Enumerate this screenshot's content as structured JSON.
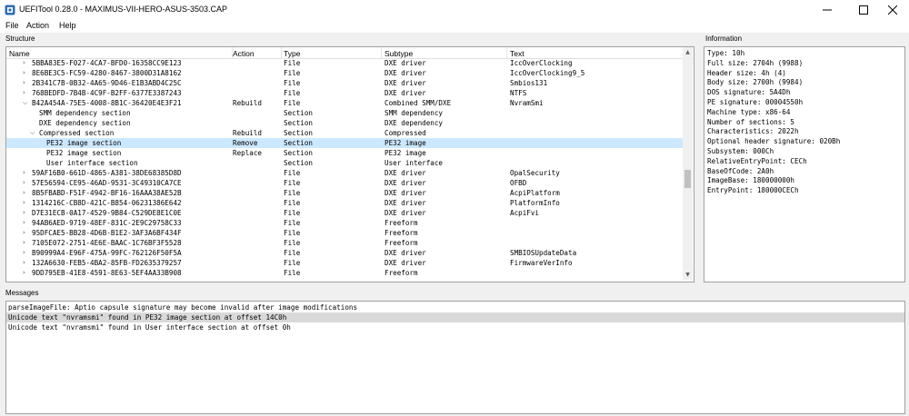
{
  "window": {
    "title": "UEFITool 0.28.0 - MAXIMUS-VII-HERO-ASUS-3503.CAP",
    "minimize_icon": "minimize-icon",
    "maximize_icon": "maximize-icon",
    "close_icon": "close-icon"
  },
  "menu": [
    "File",
    "Action",
    "Help"
  ],
  "structure": {
    "group_label": "Structure",
    "columns": [
      "Name",
      "Action",
      "Type",
      "Subtype",
      "Text"
    ],
    "rows": [
      {
        "chevron": ">",
        "name": "5BBA83E5-F027-4CA7-BFD0-16358CC9E123",
        "action": "",
        "type": "File",
        "subtype": "DXE driver",
        "text": "IccOverClocking",
        "selected": false
      },
      {
        "chevron": ">",
        "name": "8E6BE3C5-FC59-4280-8467-3800D31A8162",
        "action": "",
        "type": "File",
        "subtype": "DXE driver",
        "text": "IccOverClocking9_5",
        "selected": false
      },
      {
        "chevron": ">",
        "name": "2B341C7B-0B32-4A65-9D46-E1B3ABD4C25C",
        "action": "",
        "type": "File",
        "subtype": "DXE driver",
        "text": "Smbios131",
        "selected": false
      },
      {
        "chevron": ">",
        "name": "768BEDFD-7B4B-4C9F-B2FF-6377E3387243",
        "action": "",
        "type": "File",
        "subtype": "DXE driver",
        "text": "NTFS",
        "selected": false
      },
      {
        "chevron": "v",
        "name": "B42A454A-75E5-4008-8B1C-36420E4E3F21",
        "action": "Rebuild",
        "type": "File",
        "subtype": "Combined SMM/DXE",
        "text": "NvramSmi",
        "selected": false
      },
      {
        "chevron": "",
        "name": "SMM dependency section",
        "action": "",
        "type": "Section",
        "subtype": "SMM dependency",
        "text": "",
        "selected": false
      },
      {
        "chevron": "",
        "name": "DXE dependency section",
        "action": "",
        "type": "Section",
        "subtype": "DXE dependency",
        "text": "",
        "selected": false
      },
      {
        "chevron": "v",
        "name": "Compressed section",
        "action": "Rebuild",
        "type": "Section",
        "subtype": "Compressed",
        "text": "",
        "selected": false
      },
      {
        "chevron": "",
        "name": "PE32 image section",
        "action": "Remove",
        "type": "Section",
        "subtype": "PE32 image",
        "text": "",
        "selected": true
      },
      {
        "chevron": "",
        "name": "PE32 image section",
        "action": "Replace",
        "type": "Section",
        "subtype": "PE32 image",
        "text": "",
        "selected": false
      },
      {
        "chevron": "",
        "name": "User interface section",
        "action": "",
        "type": "Section",
        "subtype": "User interface",
        "text": "",
        "selected": false
      },
      {
        "chevron": ">",
        "name": "59AF16B0-661D-4865-A381-38DE68385D8D",
        "action": "",
        "type": "File",
        "subtype": "DXE driver",
        "text": "OpalSecurity",
        "selected": false
      },
      {
        "chevron": ">",
        "name": "57E56594-CE95-46AD-9531-3C49310CA7CE",
        "action": "",
        "type": "File",
        "subtype": "DXE driver",
        "text": "OFBD",
        "selected": false
      },
      {
        "chevron": ">",
        "name": "8B5FBABD-F51F-4942-BF16-16AAA38AE52B",
        "action": "",
        "type": "File",
        "subtype": "DXE driver",
        "text": "AcpiPlatform",
        "selected": false
      },
      {
        "chevron": ">",
        "name": "1314216C-CB8D-421C-B854-06231386E642",
        "action": "",
        "type": "File",
        "subtype": "DXE driver",
        "text": "PlatformInfo",
        "selected": false
      },
      {
        "chevron": ">",
        "name": "D7E31ECB-0A17-4529-9B84-C529DE8E1C0E",
        "action": "",
        "type": "File",
        "subtype": "DXE driver",
        "text": "AcpiFvi",
        "selected": false
      },
      {
        "chevron": ">",
        "name": "94AB6AED-9719-48EF-831C-2E9C29758C33",
        "action": "",
        "type": "File",
        "subtype": "Freeform",
        "text": "",
        "selected": false
      },
      {
        "chevron": ">",
        "name": "95DFCAE5-BB28-4D6B-B1E2-3AF3A6BF434F",
        "action": "",
        "type": "File",
        "subtype": "Freeform",
        "text": "",
        "selected": false
      },
      {
        "chevron": ">",
        "name": "7105E072-2751-4E6E-BAAC-1C76BF3F5528",
        "action": "",
        "type": "File",
        "subtype": "Freeform",
        "text": "",
        "selected": false
      },
      {
        "chevron": ">",
        "name": "B90999A4-E96F-475A-99FC-762126F50F5A",
        "action": "",
        "type": "File",
        "subtype": "DXE driver",
        "text": "SMBIOSUpdateData",
        "selected": false
      },
      {
        "chevron": ">",
        "name": "132A6630-FEB5-4BA2-85FB-FD2635379257",
        "action": "",
        "type": "File",
        "subtype": "DXE driver",
        "text": "FirmwareVerInfo",
        "selected": false
      },
      {
        "chevron": ">",
        "name": "9DD795EB-41E8-4591-8E63-5EF4AA33B908",
        "action": "",
        "type": "File",
        "subtype": "Freeform",
        "text": "",
        "selected": false
      }
    ]
  },
  "information": {
    "group_label": "Information",
    "lines": [
      "Type: 10h",
      "Full size: 2704h (9988)",
      "Header size: 4h (4)",
      "Body size: 2700h (9984)",
      "DOS signature: 5A4Dh",
      "PE signature: 00004550h",
      "Machine type: x86-64",
      "Number of sections: 5",
      "Characteristics: 2022h",
      "Optional header signature: 020Bh",
      "Subsystem: 000Ch",
      "RelativeEntryPoint: CECh",
      "BaseOfCode: 2A0h",
      "ImageBase: 180000000h",
      "EntryPoint: 180000CECh"
    ]
  },
  "messages": {
    "group_label": "Messages",
    "lines": [
      {
        "text": "parseImageFile: Aptio capsule signature may become invalid after image modifications",
        "selected": false
      },
      {
        "text": "Unicode text \"nvramsmi\" found in PE32 image section at offset 14C0h",
        "selected": true
      },
      {
        "text": "Unicode text \"nvramsmi\" found in User interface section at offset 0h",
        "selected": false
      }
    ]
  },
  "colors": {
    "selection": "#cce8ff",
    "message_selection": "#d9d9d9",
    "app_icon": "#2f6db5"
  }
}
